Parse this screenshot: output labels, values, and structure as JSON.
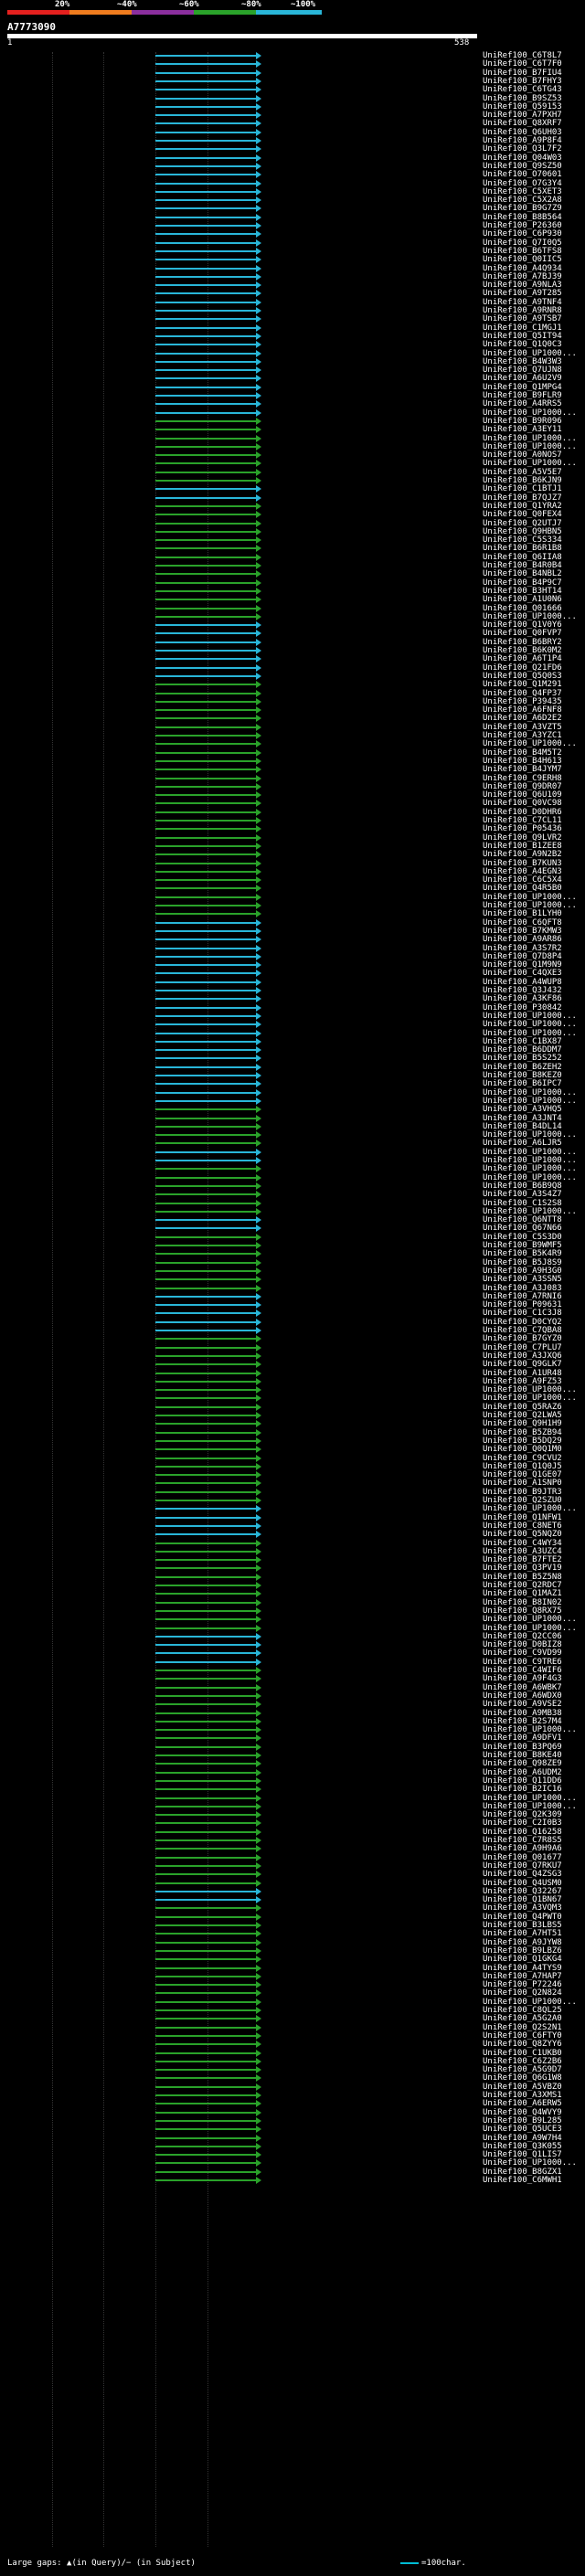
{
  "header": {
    "scale_labels": [
      "20%",
      "~40%",
      "~60%",
      "~80%",
      "~100%"
    ],
    "scale_colors": [
      "#e5201e",
      "#ef7c1e",
      "#8b2f9e",
      "#2aa22a",
      "#29b6d8"
    ],
    "query_id": "A7773090",
    "start": "1",
    "end": "538"
  },
  "hits": [
    "UniRef100_C6T8L7",
    "UniRef100_C6T7F0",
    "UniRef100_B7FIU4",
    "UniRef100_B7FHY3",
    "UniRef100_C6TG43",
    "UniRef100_B9SZ53",
    "UniRef100_Q59153",
    "UniRef100_A7PXH7",
    "UniRef100_Q8XRF7",
    "UniRef100_Q6UH03",
    "UniRef100_A9P8F4",
    "UniRef100_Q3L7F2",
    "UniRef100_Q04W03",
    "UniRef100_Q9SZ50",
    "UniRef100_O70601",
    "UniRef100_O7G3Y4",
    "UniRef100_C5XET3",
    "UniRef100_C5X2A8",
    "UniRef100_B9G7Z9",
    "UniRef100_B8B564",
    "UniRef100_P26360",
    "UniRef100_C6P930",
    "UniRef100_Q7I0Q5",
    "UniRef100_B6TFS8",
    "UniRef100_Q0IIC5",
    "UniRef100_A4Q934",
    "UniRef100_A7BJ39",
    "UniRef100_A9NLA3",
    "UniRef100_A9T285",
    "UniRef100_A9TNF4",
    "UniRef100_A9RNR8",
    "UniRef100_A9TSB7",
    "UniRef100_C1MGJ1",
    "UniRef100_Q5IT94",
    "UniRef100_Q1Q0C3",
    "UniRef100_UP1000...",
    "UniRef100_B4W3W3",
    "UniRef100_Q7UJN8",
    "UniRef100_A6U2V9",
    "UniRef100_Q1MPG4",
    "UniRef100_B9FLR9",
    "UniRef100_A4RRS5",
    "UniRef100_UP1000...",
    "UniRef100_B9R096",
    "UniRef100_A3EY11",
    "UniRef100_UP1000...",
    "UniRef100_UP1000...",
    "UniRef100_A0NOS7",
    "UniRef100_UP1000...",
    "UniRef100_A5V5E7",
    "UniRef100_B6KJN9",
    "UniRef100_C1BTJ1",
    "UniRef100_B7QJZ7",
    "UniRef100_Q1YRA2",
    "UniRef100_Q0FEX4",
    "UniRef100_Q2UTJ7",
    "UniRef100_Q9HBN5",
    "UniRef100_C5S334",
    "UniRef100_B6R1B8",
    "UniRef100_Q6IIA8",
    "UniRef100_B4R0B4",
    "UniRef100_B4NBL2",
    "UniRef100_B4P9C7",
    "UniRef100_B3HT14",
    "UniRef100_A1U0N6",
    "UniRef100_Q01666",
    "UniRef100_UP1000...",
    "UniRef100_Q1V0Y6",
    "UniRef100_Q0FVP7",
    "UniRef100_B6BRY2",
    "UniRef100_B6K0M2",
    "UniRef100_A6T1P4",
    "UniRef100_Q21FD6",
    "UniRef100_Q5Q0S3",
    "UniRef100_Q1M291",
    "UniRef100_Q4FP37",
    "UniRef100_P39435",
    "UniRef100_A6FNF8",
    "UniRef100_A6D2E2",
    "UniRef100_A3VZT5",
    "UniRef100_A3YZC1",
    "UniRef100_UP1000...",
    "UniRef100_B4M5T2",
    "UniRef100_B4H613",
    "UniRef100_B4JYM7",
    "UniRef100_C9ERH8",
    "UniRef100_Q9DR07",
    "UniRef100_Q6U109",
    "UniRef100_Q0VC98",
    "UniRef100_D0DHR6",
    "UniRef100_C7CL11",
    "UniRef100_P05436",
    "UniRef100_Q9LVR2",
    "UniRef100_B1ZEE8",
    "UniRef100_A9N2B2",
    "UniRef100_B7KUN3",
    "UniRef100_A4EGN3",
    "UniRef100_C6C5X4",
    "UniRef100_Q4R5B0",
    "UniRef100_UP1000...",
    "UniRef100_UP1000...",
    "UniRef100_B1LYH0",
    "UniRef100_C6QFT8",
    "UniRef100_B7KMW3",
    "UniRef100_A9AR86",
    "UniRef100_A3S7R2",
    "UniRef100_Q7D8P4",
    "UniRef100_Q1M9N9",
    "UniRef100_C4QXE3",
    "UniRef100_A4WUP8",
    "UniRef100_Q3J432",
    "UniRef100_A3KF86",
    "UniRef100_P30842",
    "UniRef100_UP1000...",
    "UniRef100_UP1000...",
    "UniRef100_UP1000...",
    "UniRef100_C1BX87",
    "UniRef100_B6DDM7",
    "UniRef100_B5S252",
    "UniRef100_B6ZEH2",
    "UniRef100_B8KEZ0",
    "UniRef100_B6IPC7",
    "UniRef100_UP1000...",
    "UniRef100_UP1000...",
    "UniRef100_A3VHQ5",
    "UniRef100_A3JNT4",
    "UniRef100_B4DL14",
    "UniRef100_UP1000...",
    "UniRef100_A6LJR5",
    "UniRef100_UP1000...",
    "UniRef100_UP1000...",
    "UniRef100_UP1000...",
    "UniRef100_UP1000...",
    "UniRef100_B6B9Q8",
    "UniRef100_A3S4Z7",
    "UniRef100_C1S2S8",
    "UniRef100_UP1000...",
    "UniRef100_Q6NTT8",
    "UniRef100_Q67N66",
    "UniRef100_C5S3D0",
    "UniRef100_B9WMF5",
    "UniRef100_B5K4R9",
    "UniRef100_B5J8S9",
    "UniRef100_A9H3G0",
    "UniRef100_A3SSN5",
    "UniRef100_A3J083",
    "UniRef100_A7RNI6",
    "UniRef100_P09631",
    "UniRef100_C1C3J8",
    "UniRef100_D0CYQ2",
    "UniRef100_C7QBA8",
    "UniRef100_B7GYZ0",
    "UniRef100_C7PLU7",
    "UniRef100_A3JXQ6",
    "UniRef100_Q9GLK7",
    "UniRef100_A1UR48",
    "UniRef100_A9FZ53",
    "UniRef100_UP1000...",
    "UniRef100_UP1000...",
    "UniRef100_Q5RAZ6",
    "UniRef100_Q2LWA5",
    "UniRef100_Q9H1H9",
    "UniRef100_B5ZB94",
    "UniRef100_B5DQ29",
    "UniRef100_Q0Q1M0",
    "UniRef100_C9CVU2",
    "UniRef100_Q1Q0J5",
    "UniRef100_Q1GE07",
    "UniRef100_A1SNP0",
    "UniRef100_B9JTR3",
    "UniRef100_Q2SZU0",
    "UniRef100_UP1000...",
    "UniRef100_Q1NFW1",
    "UniRef100_C8NET6",
    "UniRef100_Q5NQZ0",
    "UniRef100_C4WY34",
    "UniRef100_A3UZC4",
    "UniRef100_B7FTE2",
    "UniRef100_Q3PV19",
    "UniRef100_B5Z5N8",
    "UniRef100_Q2RDC7",
    "UniRef100_Q1MAZ1",
    "UniRef100_B8IN02",
    "UniRef100_Q8RX75",
    "UniRef100_UP1000...",
    "UniRef100_UP1000...",
    "UniRef100_Q2CC06",
    "UniRef100_D0BIZ8",
    "UniRef100_C9VD99",
    "UniRef100_C9TRE6",
    "UniRef100_C4WIF6",
    "UniRef100_A9F4G3",
    "UniRef100_A6WBK7",
    "UniRef100_A6WDX0",
    "UniRef100_A9VSE2",
    "UniRef100_A9MB38",
    "UniRef100_B2S7M4",
    "UniRef100_UP1000...",
    "UniRef100_A9DFV1",
    "UniRef100_B3PQ69",
    "UniRef100_B8KE40",
    "UniRef100_Q98ZE9",
    "UniRef100_A6UDM2",
    "UniRef100_Q11DD6",
    "UniRef100_B2IC16",
    "UniRef100_UP1000...",
    "UniRef100_UP1000...",
    "UniRef100_Q2K309",
    "UniRef100_C2I0B3",
    "UniRef100_Q16258",
    "UniRef100_C7R8S5",
    "UniRef100_A9H9A6",
    "UniRef100_Q01677",
    "UniRef100_Q7RKU7",
    "UniRef100_Q4ZSG3",
    "UniRef100_Q4USM0",
    "UniRef100_Q32267",
    "UniRef100_Q1BN67",
    "UniRef100_A3VQM3",
    "UniRef100_Q4PWT0",
    "UniRef100_B3LBS5",
    "UniRef100_A7HT51",
    "UniRef100_A9JYW8",
    "UniRef100_B9LBZ6",
    "UniRef100_Q1GKG4",
    "UniRef100_A4TYS9",
    "UniRef100_A7HAP7",
    "UniRef100_P72246",
    "UniRef100_Q2N824",
    "UniRef100_UP1000...",
    "UniRef100_C8QL25",
    "UniRef100_A5G2A0",
    "UniRef100_Q2S2N1",
    "UniRef100_C6FTY0",
    "UniRef100_Q8ZYY6",
    "UniRef100_C1UKB0",
    "UniRef100_C6Z2B6",
    "UniRef100_A5G9D7",
    "UniRef100_Q6G1W8",
    "UniRef100_A5VBZ0",
    "UniRef100_A3XMS1",
    "UniRef100_A6ERW5",
    "UniRef100_Q4WVY9",
    "UniRef100_B9L285",
    "UniRef100_Q5UCE3",
    "UniRef100_A9W7H4",
    "UniRef100_Q3K055",
    "UniRef100_Q1LIS7",
    "UniRef100_UP1000...",
    "UniRef100_B8GZX1",
    "UniRef100_C6MWH1"
  ],
  "footer": {
    "gaps_text": "Large gaps: ▲(in Query)/− (in Subject)",
    "scale_text": "=100char."
  }
}
